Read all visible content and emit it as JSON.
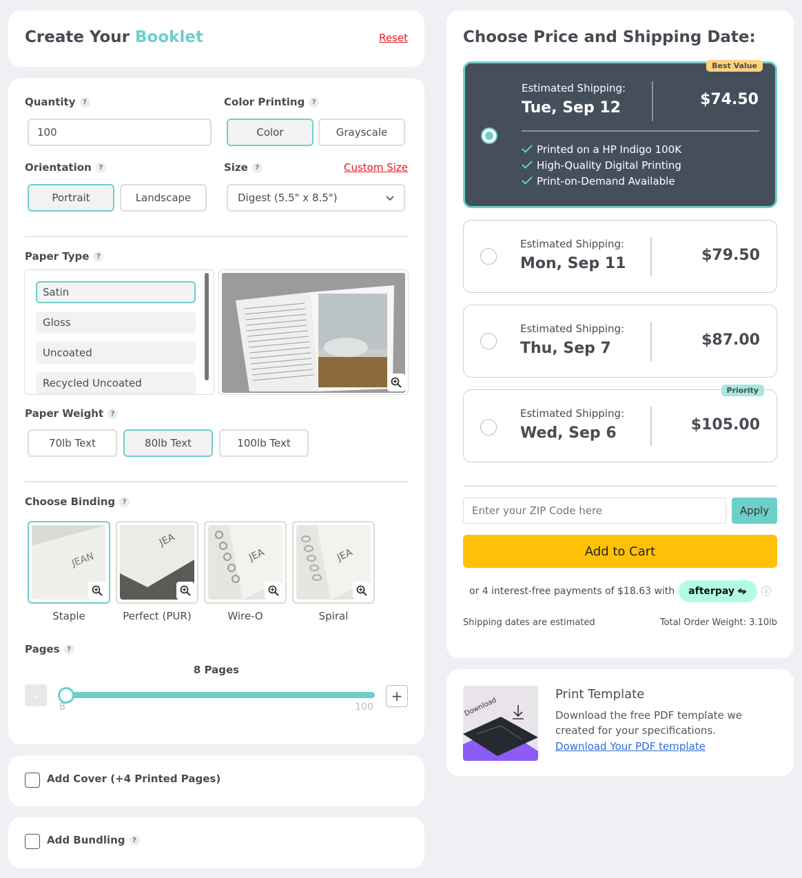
{
  "builder": {
    "title_prefix": "Create Your",
    "title_accent": "Booklet",
    "reset": "Reset"
  },
  "quantity": {
    "label": "Quantity",
    "value": "100"
  },
  "color_printing": {
    "label": "Color Printing",
    "options": [
      "Color",
      "Grayscale"
    ],
    "selected": "Color"
  },
  "orientation": {
    "label": "Orientation",
    "options": [
      "Portrait",
      "Landscape"
    ],
    "selected": "Portrait"
  },
  "size": {
    "label": "Size",
    "custom_link": "Custom Size",
    "value": "Digest (5.5\" x 8.5\")"
  },
  "paper_type": {
    "label": "Paper Type",
    "options": [
      "Satin",
      "Gloss",
      "Uncoated",
      "Recycled Uncoated"
    ],
    "selected": "Satin"
  },
  "paper_weight": {
    "label": "Paper Weight",
    "options": [
      "70lb Text",
      "80lb Text",
      "100lb Text"
    ],
    "selected": "80lb Text"
  },
  "binding": {
    "label": "Choose Binding",
    "options": [
      "Staple",
      "Perfect (PUR)",
      "Wire-O",
      "Spiral"
    ],
    "selected": "Staple"
  },
  "pages": {
    "label": "Pages",
    "value_text": "8 Pages",
    "min": "8",
    "max": "100",
    "value": 8,
    "minus": "-",
    "plus": "+"
  },
  "cover": {
    "label": "Add Cover (+4 Printed Pages)"
  },
  "bundling": {
    "label": "Add Bundling"
  },
  "pricing": {
    "title": "Choose Price and Shipping Date:",
    "est_label": "Estimated Shipping:",
    "options": [
      {
        "date": "Tue, Sep 12",
        "price": "$74.50",
        "badge": "Best Value",
        "features": [
          "Printed on a HP Indigo 100K",
          "High-Quality Digital Printing",
          "Print-on-Demand Available"
        ],
        "selected": true
      },
      {
        "date": "Mon, Sep 11",
        "price": "$79.50"
      },
      {
        "date": "Thu, Sep 7",
        "price": "$87.00"
      },
      {
        "date": "Wed, Sep 6",
        "price": "$105.00",
        "badge": "Priority"
      }
    ],
    "zip_placeholder": "Enter your ZIP Code here",
    "apply": "Apply",
    "add_to_cart": "Add to Cart",
    "afterpay_text": "or 4 interest-free payments of $18.63 with",
    "afterpay_logo": "afterpay",
    "info": "ⓘ",
    "shipping_note": "Shipping dates are estimated",
    "total_weight": "Total Order Weight: 3.10lb"
  },
  "template": {
    "title": "Print Template",
    "description": "Download the free PDF template we created for your specifications.",
    "link": "Download Your PDF template",
    "image_text": "Download"
  },
  "colors": {
    "accent": "#6ecfc9",
    "dark_panel": "#454f5c",
    "cart": "#ffc107",
    "link_red": "#e01a22",
    "best_value": "#ffd27d",
    "priority": "#a8e6e1",
    "afterpay": "#b2fce4"
  }
}
